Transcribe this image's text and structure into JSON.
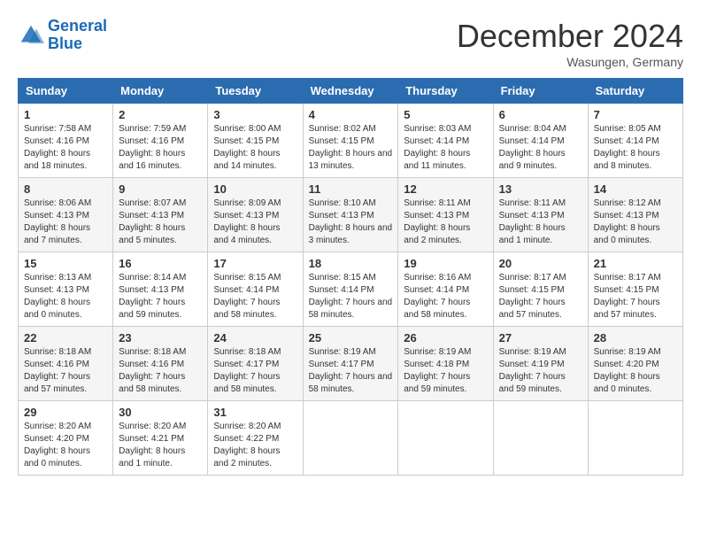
{
  "header": {
    "logo_line1": "General",
    "logo_line2": "Blue",
    "month": "December 2024",
    "location": "Wasungen, Germany"
  },
  "days_of_week": [
    "Sunday",
    "Monday",
    "Tuesday",
    "Wednesday",
    "Thursday",
    "Friday",
    "Saturday"
  ],
  "weeks": [
    [
      {
        "day": "1",
        "sunrise": "7:58 AM",
        "sunset": "4:16 PM",
        "daylight": "8 hours and 18 minutes."
      },
      {
        "day": "2",
        "sunrise": "7:59 AM",
        "sunset": "4:16 PM",
        "daylight": "8 hours and 16 minutes."
      },
      {
        "day": "3",
        "sunrise": "8:00 AM",
        "sunset": "4:15 PM",
        "daylight": "8 hours and 14 minutes."
      },
      {
        "day": "4",
        "sunrise": "8:02 AM",
        "sunset": "4:15 PM",
        "daylight": "8 hours and 13 minutes."
      },
      {
        "day": "5",
        "sunrise": "8:03 AM",
        "sunset": "4:14 PM",
        "daylight": "8 hours and 11 minutes."
      },
      {
        "day": "6",
        "sunrise": "8:04 AM",
        "sunset": "4:14 PM",
        "daylight": "8 hours and 9 minutes."
      },
      {
        "day": "7",
        "sunrise": "8:05 AM",
        "sunset": "4:14 PM",
        "daylight": "8 hours and 8 minutes."
      }
    ],
    [
      {
        "day": "8",
        "sunrise": "8:06 AM",
        "sunset": "4:13 PM",
        "daylight": "8 hours and 7 minutes."
      },
      {
        "day": "9",
        "sunrise": "8:07 AM",
        "sunset": "4:13 PM",
        "daylight": "8 hours and 5 minutes."
      },
      {
        "day": "10",
        "sunrise": "8:09 AM",
        "sunset": "4:13 PM",
        "daylight": "8 hours and 4 minutes."
      },
      {
        "day": "11",
        "sunrise": "8:10 AM",
        "sunset": "4:13 PM",
        "daylight": "8 hours and 3 minutes."
      },
      {
        "day": "12",
        "sunrise": "8:11 AM",
        "sunset": "4:13 PM",
        "daylight": "8 hours and 2 minutes."
      },
      {
        "day": "13",
        "sunrise": "8:11 AM",
        "sunset": "4:13 PM",
        "daylight": "8 hours and 1 minute."
      },
      {
        "day": "14",
        "sunrise": "8:12 AM",
        "sunset": "4:13 PM",
        "daylight": "8 hours and 0 minutes."
      }
    ],
    [
      {
        "day": "15",
        "sunrise": "8:13 AM",
        "sunset": "4:13 PM",
        "daylight": "8 hours and 0 minutes."
      },
      {
        "day": "16",
        "sunrise": "8:14 AM",
        "sunset": "4:13 PM",
        "daylight": "7 hours and 59 minutes."
      },
      {
        "day": "17",
        "sunrise": "8:15 AM",
        "sunset": "4:14 PM",
        "daylight": "7 hours and 58 minutes."
      },
      {
        "day": "18",
        "sunrise": "8:15 AM",
        "sunset": "4:14 PM",
        "daylight": "7 hours and 58 minutes."
      },
      {
        "day": "19",
        "sunrise": "8:16 AM",
        "sunset": "4:14 PM",
        "daylight": "7 hours and 58 minutes."
      },
      {
        "day": "20",
        "sunrise": "8:17 AM",
        "sunset": "4:15 PM",
        "daylight": "7 hours and 57 minutes."
      },
      {
        "day": "21",
        "sunrise": "8:17 AM",
        "sunset": "4:15 PM",
        "daylight": "7 hours and 57 minutes."
      }
    ],
    [
      {
        "day": "22",
        "sunrise": "8:18 AM",
        "sunset": "4:16 PM",
        "daylight": "7 hours and 57 minutes."
      },
      {
        "day": "23",
        "sunrise": "8:18 AM",
        "sunset": "4:16 PM",
        "daylight": "7 hours and 58 minutes."
      },
      {
        "day": "24",
        "sunrise": "8:18 AM",
        "sunset": "4:17 PM",
        "daylight": "7 hours and 58 minutes."
      },
      {
        "day": "25",
        "sunrise": "8:19 AM",
        "sunset": "4:17 PM",
        "daylight": "7 hours and 58 minutes."
      },
      {
        "day": "26",
        "sunrise": "8:19 AM",
        "sunset": "4:18 PM",
        "daylight": "7 hours and 59 minutes."
      },
      {
        "day": "27",
        "sunrise": "8:19 AM",
        "sunset": "4:19 PM",
        "daylight": "7 hours and 59 minutes."
      },
      {
        "day": "28",
        "sunrise": "8:19 AM",
        "sunset": "4:20 PM",
        "daylight": "8 hours and 0 minutes."
      }
    ],
    [
      {
        "day": "29",
        "sunrise": "8:20 AM",
        "sunset": "4:20 PM",
        "daylight": "8 hours and 0 minutes."
      },
      {
        "day": "30",
        "sunrise": "8:20 AM",
        "sunset": "4:21 PM",
        "daylight": "8 hours and 1 minute."
      },
      {
        "day": "31",
        "sunrise": "8:20 AM",
        "sunset": "4:22 PM",
        "daylight": "8 hours and 2 minutes."
      },
      null,
      null,
      null,
      null
    ]
  ]
}
